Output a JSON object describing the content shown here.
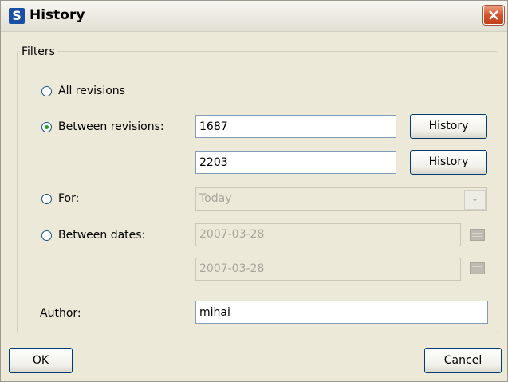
{
  "window": {
    "title": "History",
    "icon_letter": "S"
  },
  "filters": {
    "legend": "Filters",
    "all_revisions": {
      "label": "All revisions",
      "selected": false
    },
    "between_revisions": {
      "label": "Between revisions:",
      "selected": true,
      "from": "1687",
      "to": "2203",
      "history_button_1": "History",
      "history_button_2": "History"
    },
    "for": {
      "label": "For:",
      "selected": false,
      "value": "Today",
      "enabled": false
    },
    "between_dates": {
      "label": "Between dates:",
      "selected": false,
      "from": "2007-03-28",
      "to": "2007-03-28",
      "enabled": false
    },
    "author": {
      "label": "Author:",
      "value": "mihai"
    }
  },
  "footer": {
    "ok": "OK",
    "cancel": "Cancel"
  }
}
